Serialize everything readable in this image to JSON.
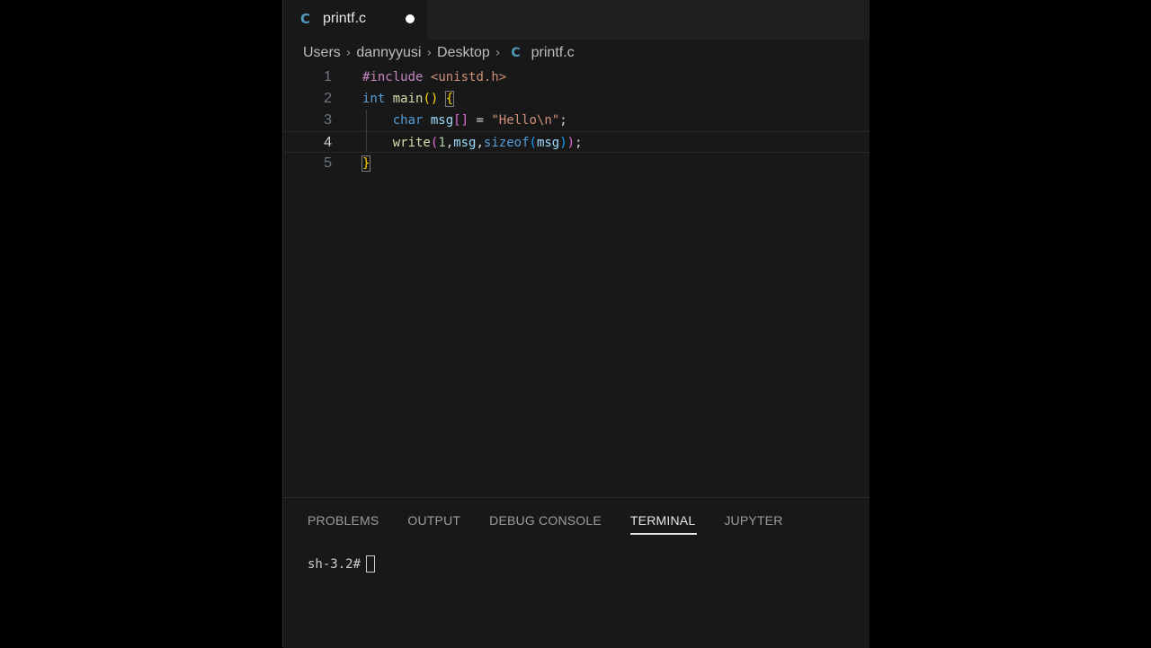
{
  "tab": {
    "icon": "c-file-icon",
    "icon_glyph": "C",
    "filename": "printf.c",
    "modified": true
  },
  "breadcrumb": {
    "items": [
      "Users",
      "dannyyusi",
      "Desktop"
    ],
    "file_icon_glyph": "C",
    "file": "printf.c"
  },
  "editor": {
    "active_line": 4,
    "line_numbers": [
      "1",
      "2",
      "3",
      "4",
      "5"
    ]
  },
  "panel": {
    "tabs": [
      "PROBLEMS",
      "OUTPUT",
      "DEBUG CONSOLE",
      "TERMINAL",
      "JUPYTER"
    ],
    "active_tab": "TERMINAL",
    "terminal_prompt": "sh-3.2#"
  },
  "colors": {
    "background": "#181818",
    "accent_c_icon": "#519aba",
    "keyword": "#569cd6",
    "string": "#ce9178",
    "function": "#dcdcaa",
    "variable": "#9cdcfe"
  }
}
